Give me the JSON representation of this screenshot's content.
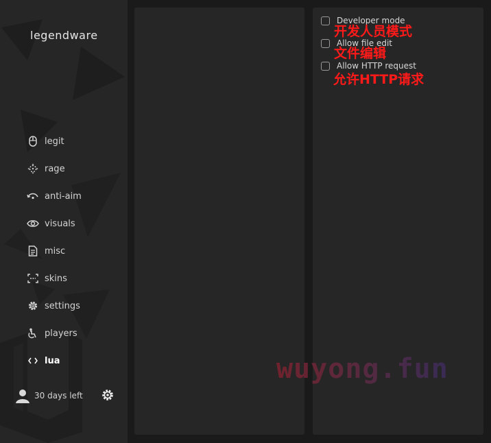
{
  "app": {
    "brand": "legendware"
  },
  "sidebar": {
    "items": [
      {
        "label": "legit",
        "icon": "mouse-icon"
      },
      {
        "label": "rage",
        "icon": "crosshair-icon"
      },
      {
        "label": "anti-aim",
        "icon": "anti-aim-icon"
      },
      {
        "label": "visuals",
        "icon": "eye-icon"
      },
      {
        "label": "misc",
        "icon": "document-icon"
      },
      {
        "label": "skins",
        "icon": "scan-icon"
      },
      {
        "label": "settings",
        "icon": "gear-icon"
      },
      {
        "label": "players",
        "icon": "players-icon"
      },
      {
        "label": "lua",
        "icon": "code-icon",
        "active": true
      }
    ],
    "footer": {
      "subscription": "30 days left",
      "avatar_icon": "user-icon",
      "settings_icon": "gear-icon"
    }
  },
  "lua_options": [
    {
      "label": "Developer mode",
      "checked": false,
      "annotation": "开发人员模式"
    },
    {
      "label": "Allow file edit",
      "checked": false,
      "annotation": "文件编辑"
    },
    {
      "label": "Allow HTTP request",
      "checked": false,
      "annotation": "允许HTTP请求"
    }
  ],
  "watermark": "wuyong.fun",
  "colors": {
    "background": "#1a1a1a",
    "panel": "#262626",
    "text": "#d4d4d4",
    "annotation": "#ff1a1a"
  }
}
